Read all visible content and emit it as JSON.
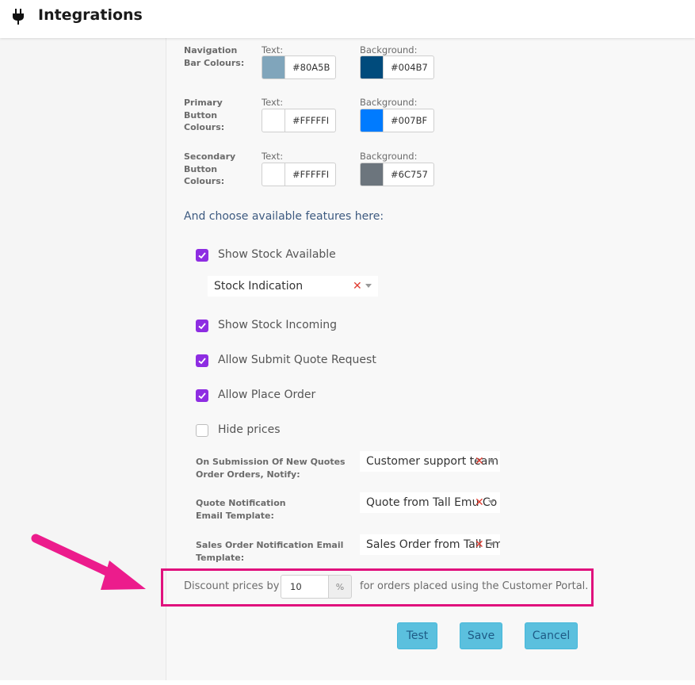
{
  "header": {
    "title": "Integrations",
    "icon": "plug-icon"
  },
  "colours": {
    "text_label": "Text:",
    "background_label": "Background:",
    "rows": [
      {
        "label": "Navigation Bar Colours:",
        "text_color": "#80A5BB",
        "text_value": "#80A5B",
        "bg_color": "#004B7C",
        "bg_value": "#004B7"
      },
      {
        "label": "Primary Button Colours:",
        "text_color": "#FFFFFF",
        "text_value": "#FFFFFI",
        "bg_color": "#007BFF",
        "bg_value": "#007BF"
      },
      {
        "label": "Secondary Button Colours:",
        "text_color": "#FFFFFF",
        "text_value": "#FFFFFI",
        "bg_color": "#6C757D",
        "bg_value": "#6C757"
      }
    ]
  },
  "features": {
    "heading": "And choose available features here:",
    "show_stock_available": {
      "label": "Show Stock Available",
      "checked": true
    },
    "stock_indication": {
      "value": "Stock Indication"
    },
    "show_stock_incoming": {
      "label": "Show Stock Incoming",
      "checked": true
    },
    "allow_submit_quote": {
      "label": "Allow Submit Quote Request",
      "checked": true
    },
    "allow_place_order": {
      "label": "Allow Place Order",
      "checked": true
    },
    "hide_prices": {
      "label": "Hide prices",
      "checked": false
    }
  },
  "notifications": {
    "notify": {
      "label": "On Submission Of New Quotes Order Orders, Notify:",
      "value": "Customer support team"
    },
    "quote_template": {
      "label": "Quote Notification Email Template:",
      "value": "Quote from Tall Emu Co"
    },
    "sales_template": {
      "label": "Sales Order Notification Email Template:",
      "value": "Sales Order from Tall Emu"
    }
  },
  "discount": {
    "prefix": "Discount prices by",
    "value": "10",
    "unit": "%",
    "suffix": "for orders placed using the Customer Portal."
  },
  "buttons": {
    "test": "Test",
    "save": "Save",
    "cancel": "Cancel"
  },
  "colors": {
    "checkbox": "#8E2DE2",
    "button": "#5BC0DE",
    "highlight": "#E0127D"
  }
}
